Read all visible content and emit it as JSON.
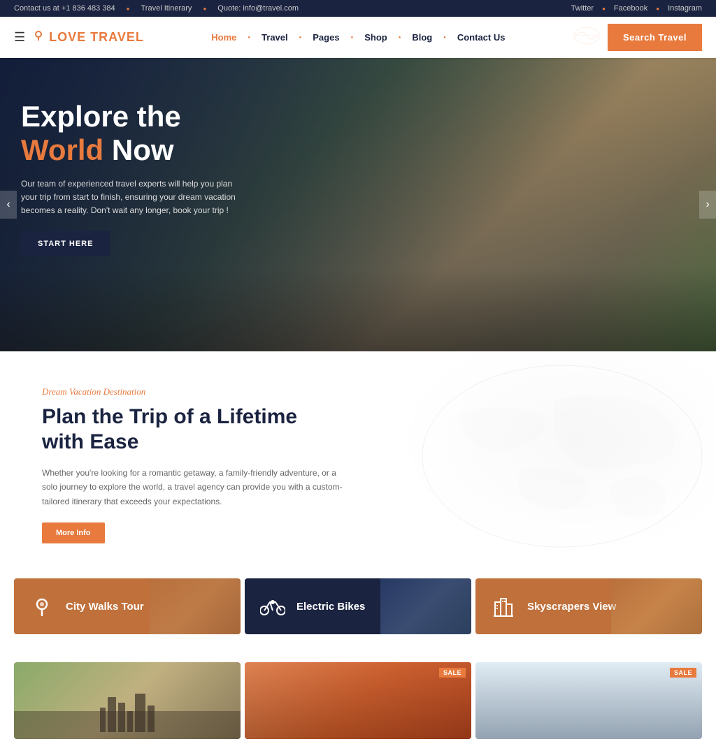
{
  "topbar": {
    "contact": "Contact us at +1 836 483 384",
    "itinerary": "Travel Itinerary",
    "quote": "Quote: info@travel.com",
    "social": [
      "Twitter",
      "Facebook",
      "Instagram"
    ]
  },
  "header": {
    "logo": "Love Travel",
    "logo_part1": "Love ",
    "logo_part2": "Travel",
    "nav": [
      {
        "label": "Home",
        "active": true
      },
      {
        "label": "Travel"
      },
      {
        "label": "Pages"
      },
      {
        "label": "Shop"
      },
      {
        "label": "Blog"
      },
      {
        "label": "Contact Us"
      }
    ],
    "search_btn": "Search Travel"
  },
  "hero": {
    "title_line1": "Explore the",
    "title_line2_orange": "World",
    "title_line2_white": " Now",
    "subtitle": "Our team of experienced travel experts will help you plan your trip from start to finish, ensuring your dream vacation becomes a reality. Don't wait any longer, book your trip !",
    "cta_btn": "START HERE",
    "arrow_left": "‹",
    "arrow_right": "›"
  },
  "dream": {
    "label": "Dream Vacation Destination",
    "title": "Plan the Trip of a Lifetime with Ease",
    "desc": "Whether you're looking for a romantic getaway, a family-friendly adventure, or a solo journey to explore the world, a travel agency can provide you with a custom-tailored itinerary that exceeds your expectations.",
    "more_info_btn": "More Info"
  },
  "tour_cards": [
    {
      "label": "City Walks Tour",
      "icon": "map-pin",
      "color": "#c0703a"
    },
    {
      "label": "Electric Bikes",
      "icon": "bike",
      "color": "#1a2340"
    },
    {
      "label": "Skyscrapers View",
      "icon": "building",
      "color": "#c0703a"
    }
  ],
  "bottom_cards": [
    {
      "sale": false
    },
    {
      "sale": true
    },
    {
      "sale": true
    }
  ]
}
